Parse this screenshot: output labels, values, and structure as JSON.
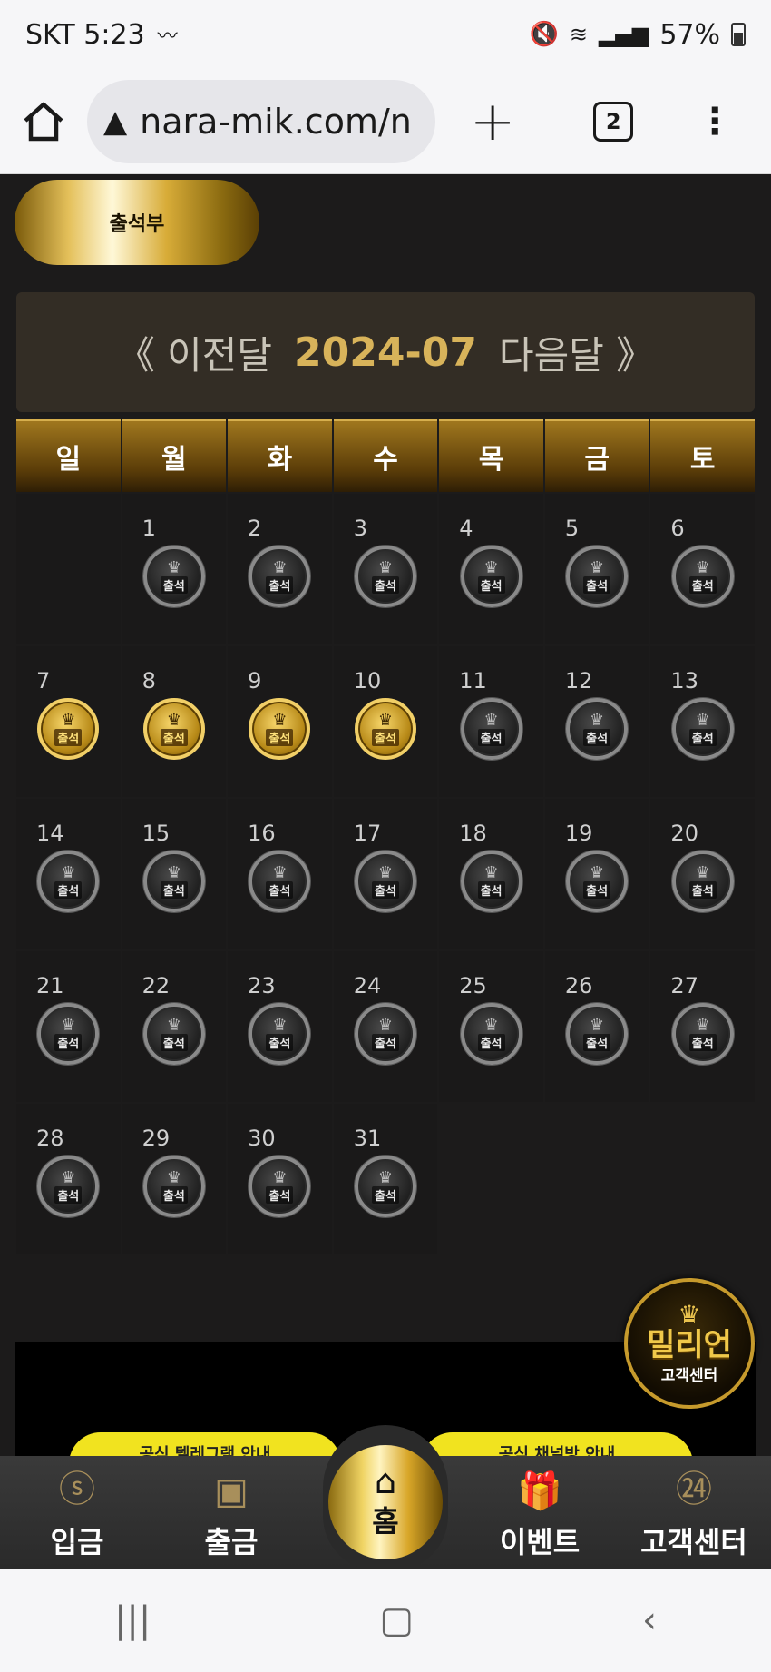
{
  "status_bar": {
    "carrier_time": "SKT 5:23",
    "battery": "57%"
  },
  "browser": {
    "url": "nara-mik.com/n",
    "tab_count": "2"
  },
  "attendance_tab": {
    "label": "출석부"
  },
  "month_nav": {
    "prev": "《 이전달",
    "current": "2024-07",
    "next": "다음달 》"
  },
  "weekdays": [
    "일",
    "월",
    "화",
    "수",
    "목",
    "금",
    "토"
  ],
  "calendar": {
    "stamp_label": "출석",
    "leading_empty": 1,
    "days": [
      {
        "day": "1",
        "attended": false
      },
      {
        "day": "2",
        "attended": false
      },
      {
        "day": "3",
        "attended": false
      },
      {
        "day": "4",
        "attended": false
      },
      {
        "day": "5",
        "attended": false
      },
      {
        "day": "6",
        "attended": false
      },
      {
        "day": "7",
        "attended": true
      },
      {
        "day": "8",
        "attended": true
      },
      {
        "day": "9",
        "attended": true
      },
      {
        "day": "10",
        "attended": true
      },
      {
        "day": "11",
        "attended": false
      },
      {
        "day": "12",
        "attended": false
      },
      {
        "day": "13",
        "attended": false
      },
      {
        "day": "14",
        "attended": false
      },
      {
        "day": "15",
        "attended": false
      },
      {
        "day": "16",
        "attended": false
      },
      {
        "day": "17",
        "attended": false
      },
      {
        "day": "18",
        "attended": false
      },
      {
        "day": "19",
        "attended": false
      },
      {
        "day": "20",
        "attended": false
      },
      {
        "day": "21",
        "attended": false
      },
      {
        "day": "22",
        "attended": false
      },
      {
        "day": "23",
        "attended": false
      },
      {
        "day": "24",
        "attended": false
      },
      {
        "day": "25",
        "attended": false
      },
      {
        "day": "26",
        "attended": false
      },
      {
        "day": "27",
        "attended": false
      },
      {
        "day": "28",
        "attended": false
      },
      {
        "day": "29",
        "attended": false
      },
      {
        "day": "30",
        "attended": false
      },
      {
        "day": "31",
        "attended": false
      }
    ]
  },
  "promo": {
    "left_pill": "공식 텔레그램 안내",
    "right_pill": "공식 채널방 안내"
  },
  "cs_badge": {
    "brand": "밀리언",
    "sub": "고객센터"
  },
  "bottom_nav": {
    "deposit": "입금",
    "withdraw": "출금",
    "home": "홈",
    "event": "이벤트",
    "support": "고객센터"
  },
  "colors": {
    "gold": "#d8b35a",
    "background": "#1c1b1b",
    "promo_yellow": "#f1e31f"
  }
}
